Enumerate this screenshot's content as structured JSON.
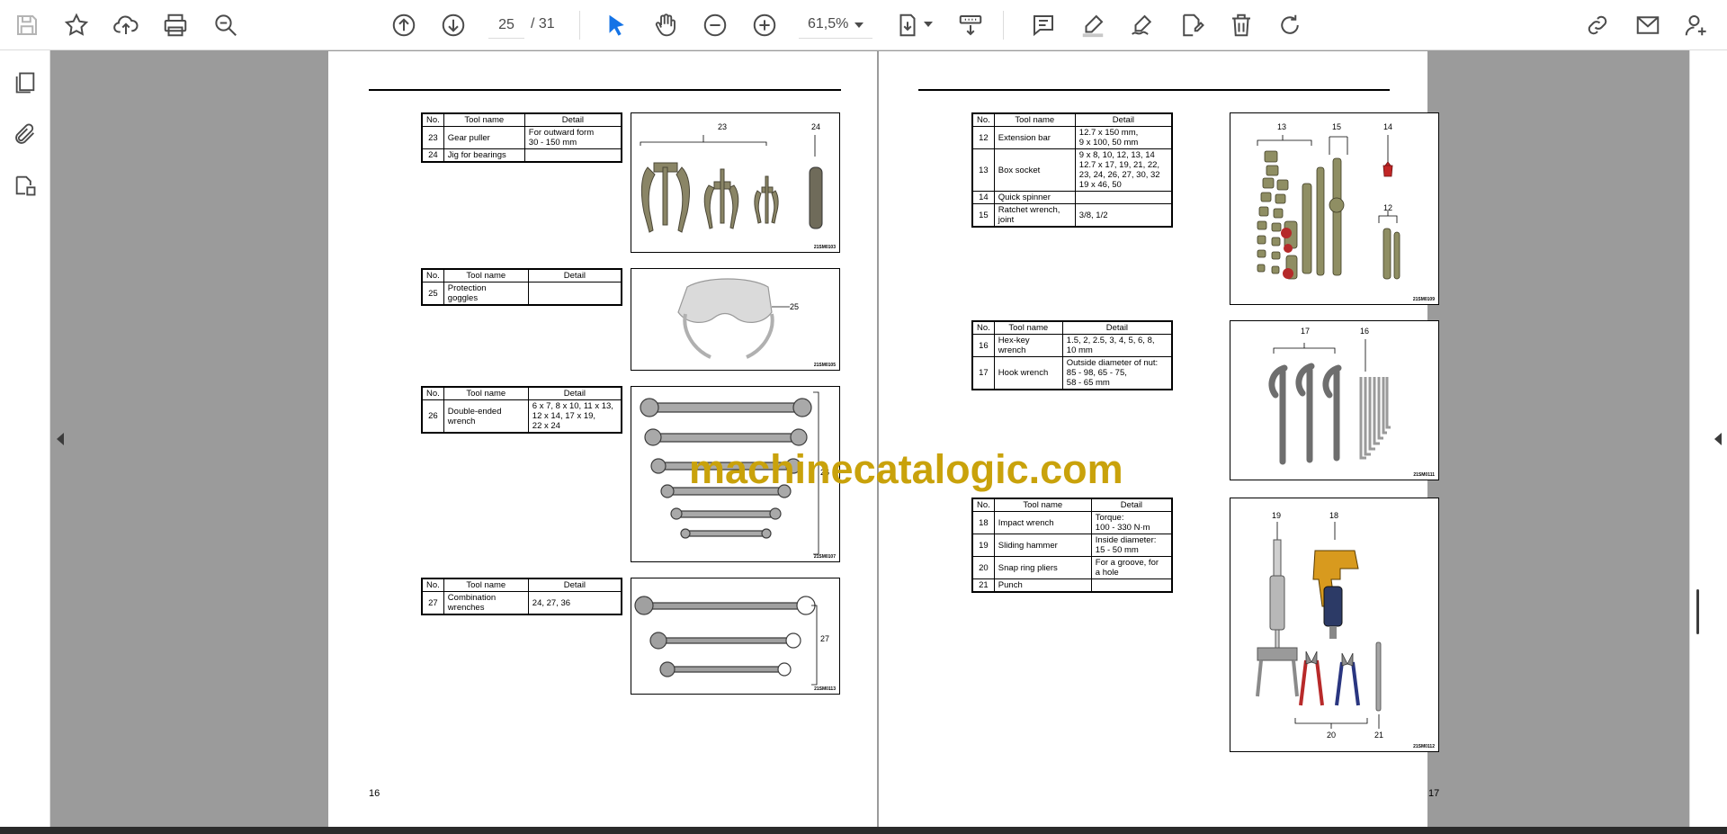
{
  "toolbar": {
    "page_current": "25",
    "page_total": "/ 31",
    "zoom": "61,5%",
    "icons": [
      "save-icon",
      "bookmark-star-icon",
      "upload-cloud-icon",
      "print-icon",
      "zoom-search-icon",
      "page-up-icon",
      "page-down-icon",
      "select-pointer-icon",
      "hand-pan-icon",
      "zoom-out-icon",
      "zoom-in-icon",
      "fit-page-icon",
      "scroll-mode-icon",
      "comment-icon",
      "highlight-pen-icon",
      "draw-sign-icon",
      "stamp-icon",
      "delete-icon",
      "redo-icon",
      "share-link-icon",
      "mail-icon",
      "add-user-icon"
    ],
    "accent_color": "#1473e6"
  },
  "left_rail": {
    "icons": [
      "page-thumbnails-icon",
      "attachments-icon",
      "layers-icon"
    ]
  },
  "watermark": "machinecatalogic.com",
  "page_left": {
    "page_number": "16",
    "tables": [
      {
        "headers": [
          "No.",
          "Tool name",
          "Detail"
        ],
        "rows": [
          {
            "no": "23",
            "name": "Gear puller",
            "detail": "For outward form\n30 - 150 mm"
          },
          {
            "no": "24",
            "name": "Jig for bearings",
            "detail": ""
          }
        ]
      },
      {
        "headers": [
          "No.",
          "Tool name",
          "Detail"
        ],
        "rows": [
          {
            "no": "25",
            "name": "Protection\ngoggles",
            "detail": ""
          }
        ]
      },
      {
        "headers": [
          "No.",
          "Tool name",
          "Detail"
        ],
        "rows": [
          {
            "no": "26",
            "name": "Double-ended\nwrench",
            "detail": "6 x 7, 8 x 10, 11 x 13,\n12 x 14, 17 x 19,\n22 x 24"
          }
        ]
      },
      {
        "headers": [
          "No.",
          "Tool name",
          "Detail"
        ],
        "rows": [
          {
            "no": "27",
            "name": "Combination\nwrenches",
            "detail": "24, 27, 36"
          }
        ]
      }
    ],
    "images": [
      {
        "callouts": [
          "23",
          "24"
        ],
        "code": "21SM0103"
      },
      {
        "callouts": [
          "25"
        ],
        "code": "21SM0105"
      },
      {
        "callouts": [
          "26"
        ],
        "code": "21SM0107"
      },
      {
        "callouts": [
          "27"
        ],
        "code": "21SM0113"
      }
    ]
  },
  "page_right": {
    "page_number": "17",
    "tables": [
      {
        "headers": [
          "No.",
          "Tool name",
          "Detail"
        ],
        "rows": [
          {
            "no": "12",
            "name": "Extension bar",
            "detail": "12.7 x 150 mm,\n9 x 100, 50 mm"
          },
          {
            "no": "13",
            "name": "Box socket",
            "detail": "9 x 8, 10, 12, 13, 14\n12.7 x 17, 19, 21, 22,\n23, 24, 26, 27, 30, 32\n19 x 46, 50"
          },
          {
            "no": "14",
            "name": "Quick spinner",
            "detail": ""
          },
          {
            "no": "15",
            "name": "Ratchet wrench,\njoint",
            "detail": "3/8, 1/2"
          }
        ]
      },
      {
        "headers": [
          "No.",
          "Tool name",
          "Detail"
        ],
        "rows": [
          {
            "no": "16",
            "name": "Hex-key\nwrench",
            "detail": "1.5, 2, 2.5, 3, 4, 5, 6, 8,\n10 mm"
          },
          {
            "no": "17",
            "name": "Hook wrench",
            "detail": "Outside diameter of nut:\n85 - 98, 65 - 75,\n58 - 65 mm"
          }
        ]
      },
      {
        "headers": [
          "No.",
          "Tool name",
          "Detail"
        ],
        "rows": [
          {
            "no": "18",
            "name": "Impact wrench",
            "detail": "Torque:\n100 - 330 N·m"
          },
          {
            "no": "19",
            "name": "Sliding hammer",
            "detail": "Inside diameter:\n15 - 50 mm"
          },
          {
            "no": "20",
            "name": "Snap ring pliers",
            "detail": "For a groove, for\na hole"
          },
          {
            "no": "21",
            "name": "Punch",
            "detail": ""
          }
        ]
      }
    ],
    "images": [
      {
        "callouts": [
          "13",
          "15",
          "14",
          "12"
        ],
        "code": "21SM0109"
      },
      {
        "callouts": [
          "17",
          "16"
        ],
        "code": "21SM0111"
      },
      {
        "callouts": [
          "19",
          "18",
          "20",
          "21"
        ],
        "code": "21SM0112"
      }
    ]
  }
}
